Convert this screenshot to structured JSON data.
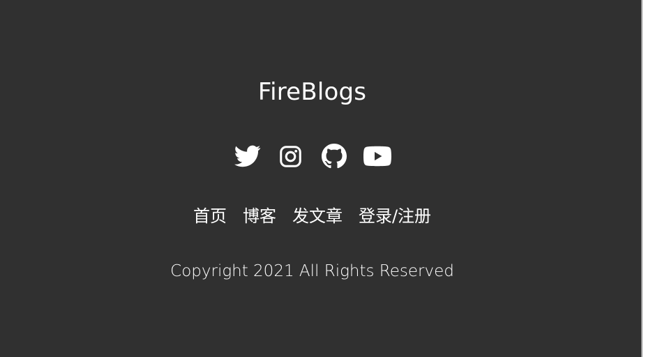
{
  "footer": {
    "brand": "FireBlogs",
    "socials": [
      {
        "name": "twitter",
        "icon": "twitter-icon"
      },
      {
        "name": "instagram",
        "icon": "instagram-icon"
      },
      {
        "name": "github",
        "icon": "github-icon"
      },
      {
        "name": "youtube",
        "icon": "youtube-icon"
      }
    ],
    "nav": {
      "home": "首页",
      "blogs": "博客",
      "create_post": "发文章",
      "login_register": "登录/注册"
    },
    "copyright": "Copyright 2021 All Rights Reserved"
  },
  "colors": {
    "footer_bg": "#303030",
    "text": "#ffffff"
  }
}
